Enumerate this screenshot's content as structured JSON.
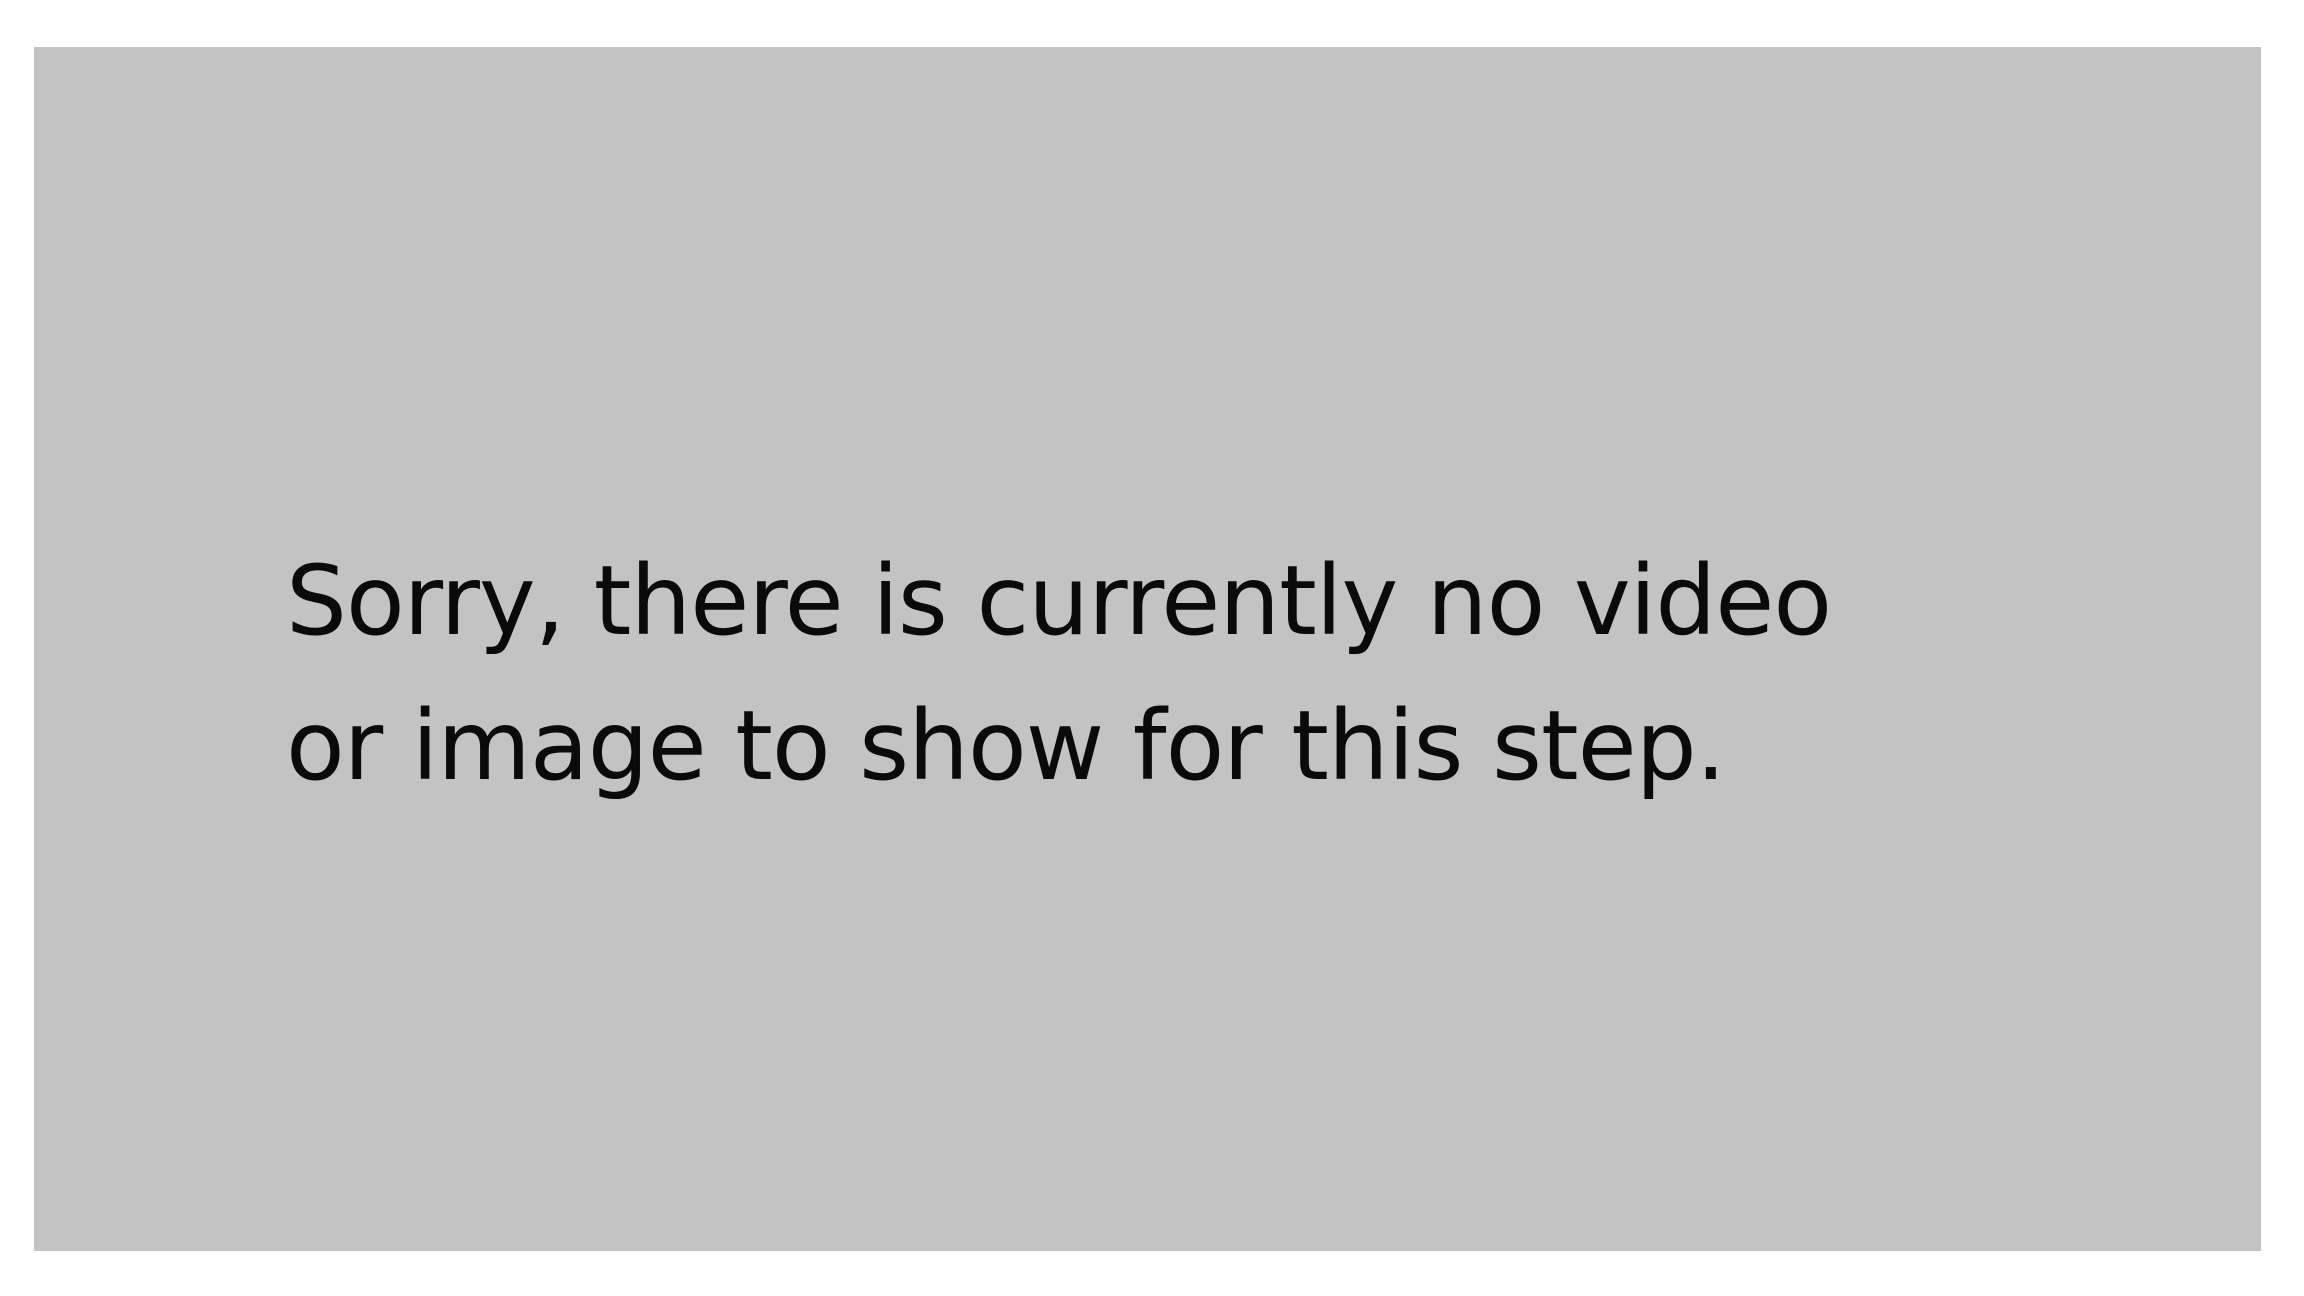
{
  "message": {
    "line1": "Sorry, there is currently no video",
    "line2": "or image to show for this step."
  },
  "colors": {
    "background": "#ffffff",
    "panel": "#c3c3c3",
    "text": "#0a0a0a"
  }
}
